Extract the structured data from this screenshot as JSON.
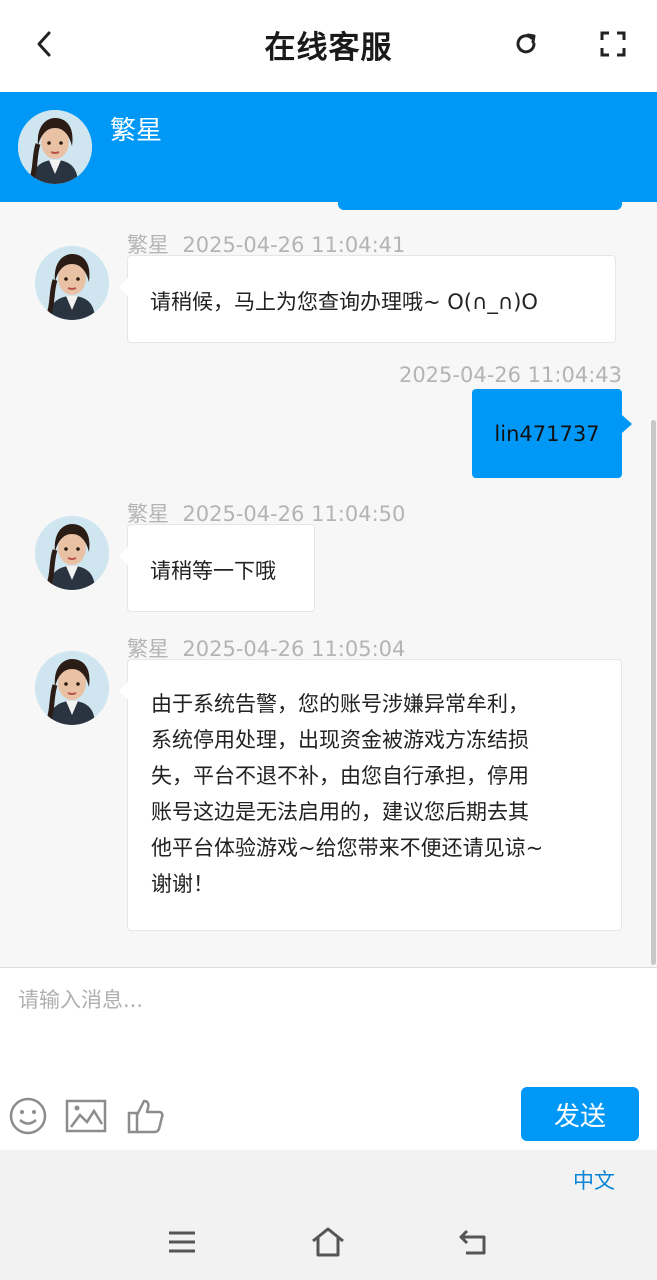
{
  "header": {
    "title": "在线客服"
  },
  "agent": {
    "name": "繁星"
  },
  "messages": [
    {
      "sender": "繁星",
      "time": "2025-04-26 11:04:41",
      "text": "请稍候，马上为您查询办理哦~ O(∩_∩)O",
      "direction": "in"
    },
    {
      "time": "2025-04-26 11:04:43",
      "text": "lin471737",
      "direction": "out"
    },
    {
      "sender": "繁星",
      "time": "2025-04-26 11:04:50",
      "text": "请稍等一下哦",
      "direction": "in"
    },
    {
      "sender": "繁星",
      "time": "2025-04-26 11:05:04",
      "direction": "in",
      "lines": [
        "由于系统告警，您的账号涉嫌异常牟利，",
        "系统停用处理，出现资金被游戏方冻结损",
        "失，平台不退不补，由您自行承担，停用",
        "账号这边是无法启用的，建议您后期去其",
        "他平台体验游戏~给您带来不便还请见谅~",
        "谢谢！"
      ]
    }
  ],
  "composer": {
    "placeholder": "请输入消息...",
    "send_label": "发送"
  },
  "footer": {
    "language": "中文"
  },
  "colors": {
    "accent": "#0098f7",
    "background": "#f7f7f7"
  },
  "icons": [
    "back-icon",
    "refresh-icon",
    "fullscreen-icon",
    "emoji-icon",
    "image-icon",
    "thumbs-up-icon",
    "menu-icon",
    "home-icon",
    "return-icon"
  ]
}
